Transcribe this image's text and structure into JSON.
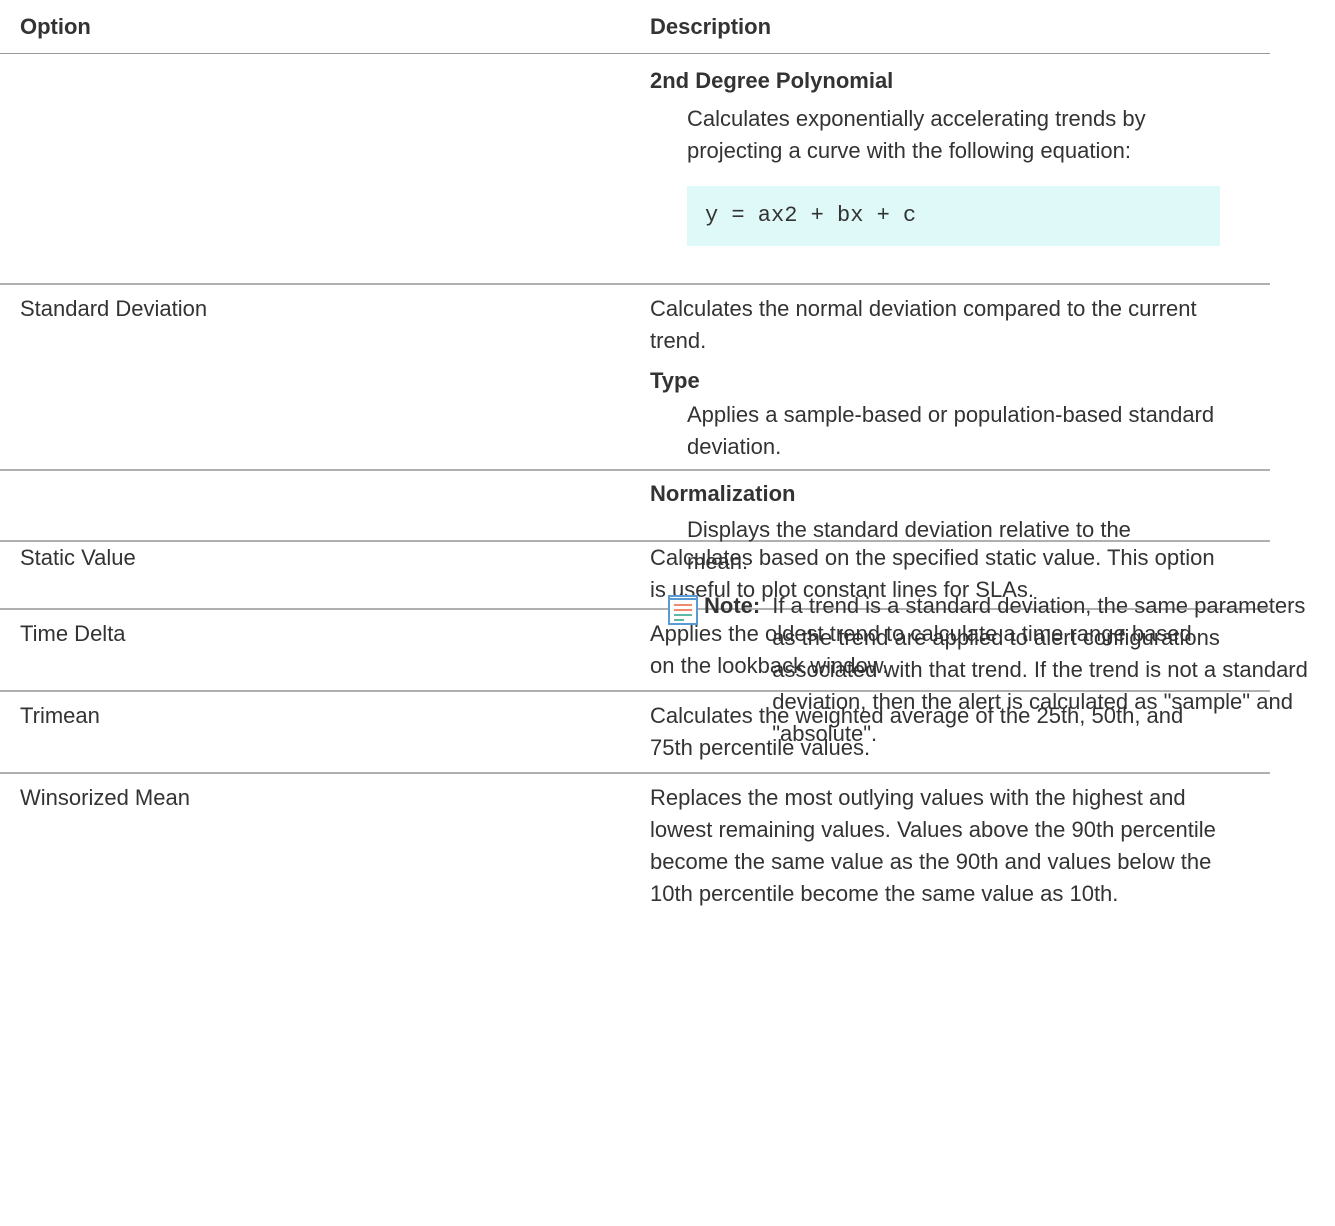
{
  "header": {
    "option": "Option",
    "description": "Description"
  },
  "polynomial": {
    "term": "2nd Degree Polynomial",
    "definition": "Calculates exponentially accelerating trends by projecting a curve with the following equation:",
    "equation": "y = ax2 + bx + c"
  },
  "standard_deviation": {
    "option": "Standard Deviation",
    "description": "Calculates the normal deviation compared to the current trend.",
    "type_term": "Type",
    "type_definition": "Applies a sample-based or population-based standard deviation.",
    "normalization_term": "Normalization",
    "normalization_definition": "Displays the standard deviation relative to the mean.",
    "note_label": "Note:",
    "note_text": "If a trend is a standard deviation, the same parameters as the trend are applied to alert configurations associated with that trend. If the trend is not a standard deviation, then the alert is calculated as \"sample\" and \"absolute\"."
  },
  "rows": [
    {
      "option": "Static Value",
      "description": "Calculates based on the specified static value. This option is useful to plot constant lines for SLAs."
    },
    {
      "option": "Time Delta",
      "description": "Applies the oldest trend to calculate a time range based on the lookback window."
    },
    {
      "option": "Trimean",
      "description": "Calculates the weighted average of the 25th, 50th, and 75th percentile values."
    },
    {
      "option": "Winsorized Mean",
      "description": "Replaces the most outlying values with the highest and lowest remaining values. Values above the 90th percentile become the same value as the 90th and values below the 10th percentile become the same value as 10th."
    }
  ]
}
